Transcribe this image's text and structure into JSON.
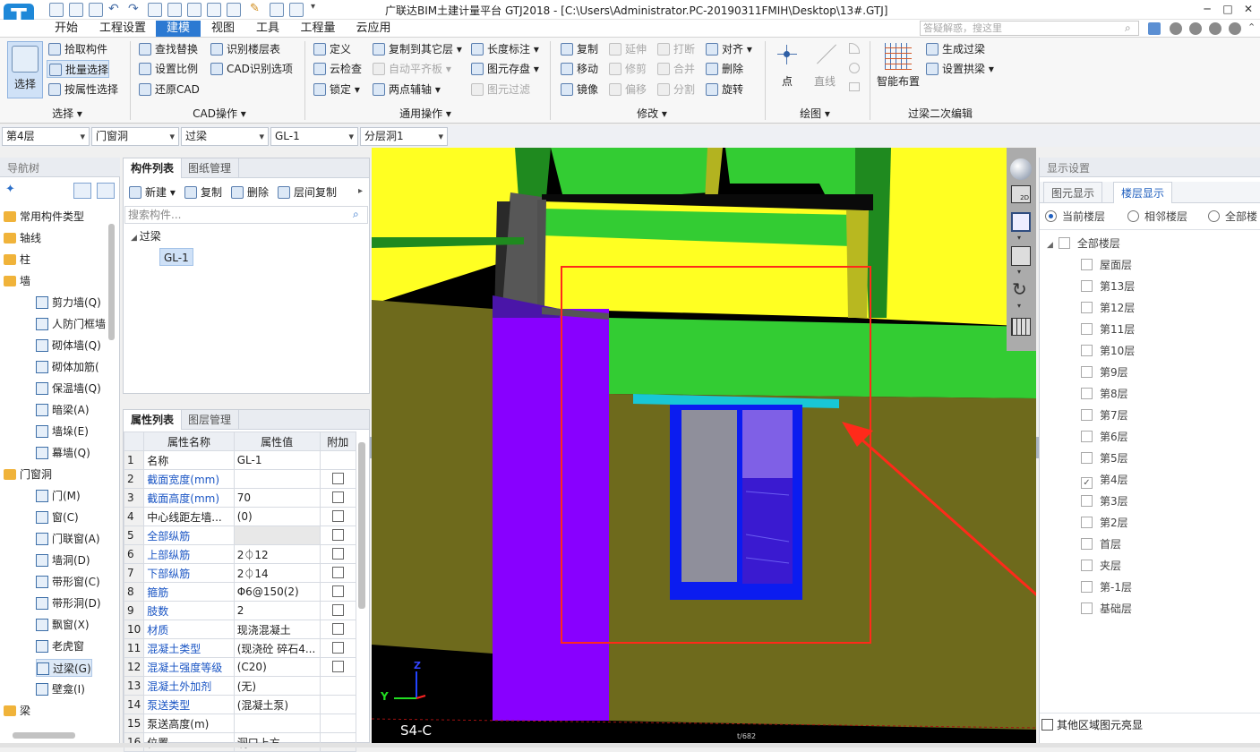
{
  "title": "广联达BIM土建计量平台 GTJ2018 - [C:\\Users\\Administrator.PC-20190311FMIH\\Desktop\\13#.GTJ]",
  "logo_letter": "T",
  "window_controls": {
    "minimize": "─",
    "maximize": "□",
    "close": "✕"
  },
  "menu": [
    "开始",
    "工程设置",
    "建模",
    "视图",
    "工具",
    "工程量",
    "云应用"
  ],
  "search_help_placeholder": "答疑解惑，搜这里",
  "ribbon": {
    "select": {
      "big": "选择",
      "items": [
        "拾取构件",
        "批量选择",
        "按属性选择"
      ],
      "group": "选择 ▾"
    },
    "cad": {
      "items": [
        "查找替换",
        "识别楼层表",
        "设置比例",
        "CAD识别选项",
        "还原CAD"
      ],
      "group": "CAD操作 ▾"
    },
    "common": {
      "items": [
        "定义",
        "复制到其它层 ▾",
        "长度标注 ▾",
        "云检查",
        "自动平齐板 ▾",
        "图元存盘 ▾",
        "锁定 ▾",
        "两点辅轴 ▾",
        "图元过滤"
      ],
      "group": "通用操作 ▾"
    },
    "modify": {
      "items": [
        "复制",
        "延伸",
        "打断",
        "对齐 ▾",
        "移动",
        "修剪",
        "合并",
        "删除",
        "镜像",
        "偏移",
        "分割",
        "旋转"
      ],
      "group": "修改 ▾"
    },
    "draw": {
      "items": [
        "点",
        "直线"
      ],
      "group": "绘图 ▾"
    },
    "lintel": {
      "big": "智能布置",
      "items": [
        "生成过梁",
        "设置拱梁 ▾"
      ],
      "group": "过梁二次编辑"
    }
  },
  "selectors": [
    "第4层",
    "门窗洞",
    "过梁",
    "GL-1",
    "分层洞1"
  ],
  "nav": {
    "title": "导航树",
    "items": [
      {
        "label": "常用构件类型",
        "level": 0
      },
      {
        "label": "轴线",
        "level": 0
      },
      {
        "label": "柱",
        "level": 0
      },
      {
        "label": "墙",
        "level": 0
      },
      {
        "label": "剪力墙(Q)",
        "level": 1
      },
      {
        "label": "人防门框墙",
        "level": 1
      },
      {
        "label": "砌体墙(Q)",
        "level": 1
      },
      {
        "label": "砌体加筋(",
        "level": 1
      },
      {
        "label": "保温墙(Q)",
        "level": 1
      },
      {
        "label": "暗梁(A)",
        "level": 1
      },
      {
        "label": "墙垛(E)",
        "level": 1
      },
      {
        "label": "幕墙(Q)",
        "level": 1
      },
      {
        "label": "门窗洞",
        "level": 0
      },
      {
        "label": "门(M)",
        "level": 1
      },
      {
        "label": "窗(C)",
        "level": 1
      },
      {
        "label": "门联窗(A)",
        "level": 1
      },
      {
        "label": "墙洞(D)",
        "level": 1
      },
      {
        "label": "带形窗(C)",
        "level": 1
      },
      {
        "label": "带形洞(D)",
        "level": 1
      },
      {
        "label": "飘窗(X)",
        "level": 1
      },
      {
        "label": "老虎窗",
        "level": 1
      },
      {
        "label": "过梁(G)",
        "level": 1
      },
      {
        "label": "壁龛(I)",
        "level": 1
      },
      {
        "label": "梁",
        "level": 0
      }
    ]
  },
  "components": {
    "tabs": [
      "构件列表",
      "图纸管理"
    ],
    "toolbar": [
      "新建 ▾",
      "复制",
      "删除",
      "层间复制"
    ],
    "search_placeholder": "搜索构件...",
    "tree_root": "过梁",
    "tree_item": "GL-1"
  },
  "properties": {
    "tabs": [
      "属性列表",
      "图层管理"
    ],
    "headers": [
      "属性名称",
      "属性值",
      "附加"
    ],
    "rows": [
      {
        "no": "1",
        "name": "名称",
        "value": "GL-1",
        "check": false
      },
      {
        "no": "2",
        "name": "截面宽度(mm)",
        "value": "",
        "check": true
      },
      {
        "no": "3",
        "name": "截面高度(mm)",
        "value": "70",
        "check": true
      },
      {
        "no": "4",
        "name": "中心线距左墙...",
        "value": "(0)",
        "check": true
      },
      {
        "no": "5",
        "name": "全部纵筋",
        "value": "",
        "check": true
      },
      {
        "no": "6",
        "name": "上部纵筋",
        "value": "2⏀12",
        "check": true
      },
      {
        "no": "7",
        "name": "下部纵筋",
        "value": "2⏀14",
        "check": true
      },
      {
        "no": "8",
        "name": "箍筋",
        "value": "Φ6@150(2)",
        "check": true
      },
      {
        "no": "9",
        "name": "肢数",
        "value": "2",
        "check": true
      },
      {
        "no": "10",
        "name": "材质",
        "value": "现浇混凝土",
        "check": true
      },
      {
        "no": "11",
        "name": "混凝土类型",
        "value": "(现浇砼 碎石4...",
        "check": true
      },
      {
        "no": "12",
        "name": "混凝土强度等级",
        "value": "(C20)",
        "check": true
      },
      {
        "no": "13",
        "name": "混凝土外加剂",
        "value": "(无)",
        "check": false
      },
      {
        "no": "14",
        "name": "泵送类型",
        "value": "(混凝土泵)",
        "check": false
      },
      {
        "no": "15",
        "name": "泵送高度(m)",
        "value": "",
        "check": false
      },
      {
        "no": "16",
        "name": "位置",
        "value": "洞口上方",
        "check": false
      }
    ]
  },
  "viewport": {
    "axis_z": "Z",
    "axis_y": "Y",
    "grid_label": "S4-C",
    "mini_label": "t/682"
  },
  "display": {
    "title": "显示设置",
    "tabs": [
      "图元显示",
      "楼层显示"
    ],
    "radios": [
      "当前楼层",
      "相邻楼层",
      "全部楼"
    ],
    "all_floors": "全部楼层",
    "floors": [
      {
        "label": "屋面层",
        "checked": false
      },
      {
        "label": "第13层",
        "checked": false
      },
      {
        "label": "第12层",
        "checked": false
      },
      {
        "label": "第11层",
        "checked": false
      },
      {
        "label": "第10层",
        "checked": false
      },
      {
        "label": "第9层",
        "checked": false
      },
      {
        "label": "第8层",
        "checked": false
      },
      {
        "label": "第7层",
        "checked": false
      },
      {
        "label": "第6层",
        "checked": false
      },
      {
        "label": "第5层",
        "checked": false
      },
      {
        "label": "第4层",
        "checked": true
      },
      {
        "label": "第3层",
        "checked": false
      },
      {
        "label": "第2层",
        "checked": false
      },
      {
        "label": "首层",
        "checked": false
      },
      {
        "label": "夹层",
        "checked": false
      },
      {
        "label": "第-1层",
        "checked": false
      },
      {
        "label": "基础层",
        "checked": false
      }
    ],
    "footer": "其他区域图元亮显"
  },
  "colors": {
    "accent": "#2b79d2",
    "annotation": "#ff2a1a"
  }
}
